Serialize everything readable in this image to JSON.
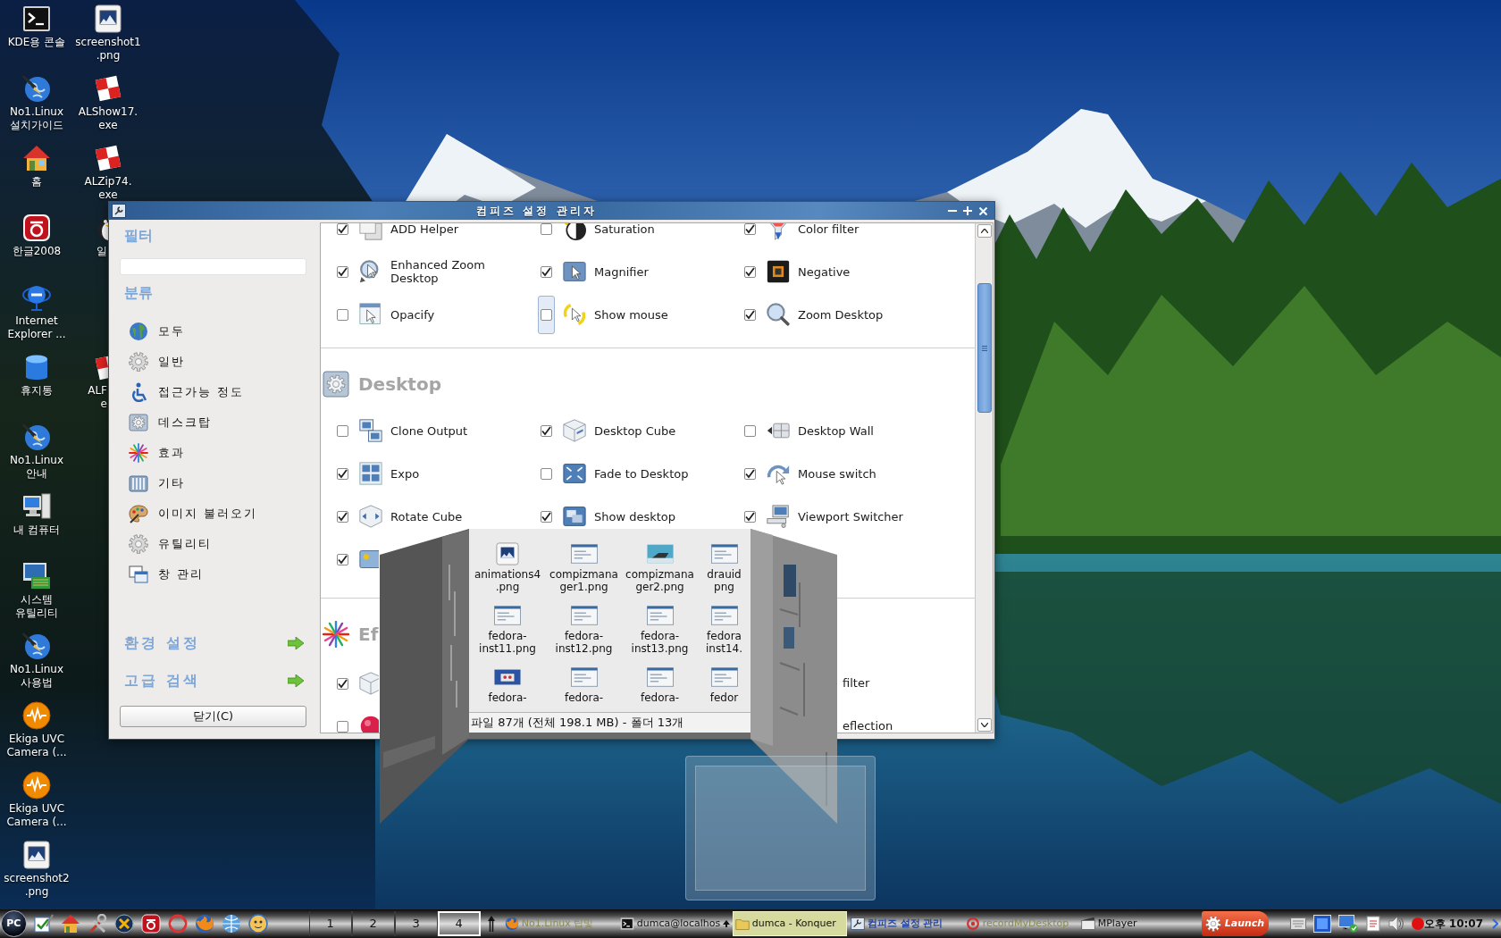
{
  "desktop_icons": {
    "column_1": [
      {
        "lines": [
          "KDE용 콘솔"
        ],
        "kind": "terminal"
      },
      {
        "lines": [
          "No1.Linux",
          "설치가이드"
        ],
        "kind": "globe_pen"
      },
      {
        "lines": [
          "홈"
        ],
        "kind": "house"
      },
      {
        "lines": [
          "한글2008"
        ],
        "kind": "red_badge"
      },
      {
        "lines": [
          "Internet",
          "Explorer ..."
        ],
        "kind": "globe_ring"
      },
      {
        "lines": [
          "휴지통"
        ],
        "kind": "bin"
      },
      {
        "lines": [
          "No1.Linux",
          "안내"
        ],
        "kind": "globe_pen"
      },
      {
        "lines": [
          "내 컴퓨터"
        ],
        "kind": "computer"
      },
      {
        "lines": [
          "시스템",
          "유틸리티"
        ],
        "kind": "monitor_board"
      },
      {
        "lines": [
          "No1.Linux",
          "사용법"
        ],
        "kind": "globe_pen"
      },
      {
        "lines": [
          "Ekiga UVC",
          "Camera (..."
        ],
        "kind": "wave_circle"
      },
      {
        "lines": [
          "Ekiga UVC",
          "Camera (..."
        ],
        "kind": "wave_circle"
      },
      {
        "lines": [
          "screenshot2",
          ".png"
        ],
        "kind": "image_file"
      }
    ],
    "column_2": [
      {
        "lines": [
          "screenshot1",
          ".png"
        ],
        "kind": "image_file"
      },
      {
        "lines": [
          "ALShow17.",
          "exe"
        ],
        "kind": "checker"
      },
      {
        "lines": [
          "ALZip74.",
          "exe"
        ],
        "kind": "checker"
      },
      {
        "lines": [
          "일"
        ],
        "kind": "penguin"
      },
      {
        "lines": [
          "ALF",
          "e"
        ],
        "kind": "checker"
      }
    ]
  },
  "window": {
    "title": "컴피즈 설정 관리자",
    "sidebar": {
      "filter_heading": "필터",
      "category_heading": "분류",
      "categories": [
        {
          "label": "모두",
          "kind": "globe",
          "selected": false
        },
        {
          "label": "일반",
          "kind": "gear",
          "selected": false
        },
        {
          "label": "접근가능 정도",
          "kind": "wheelchair",
          "selected": false
        },
        {
          "label": "데스크탑",
          "kind": "gear_tile",
          "selected": false
        },
        {
          "label": "효과",
          "kind": "starburst",
          "selected": false
        },
        {
          "label": "기타",
          "kind": "pillars",
          "selected": false
        },
        {
          "label": "이미지 불러오기",
          "kind": "palette",
          "selected": false
        },
        {
          "label": "유틸리티",
          "kind": "gear",
          "selected": false
        },
        {
          "label": "창 관리",
          "kind": "windows",
          "selected": false
        }
      ],
      "links": [
        "환경 설정",
        "고급 검색"
      ],
      "close_button": "닫기(C)"
    },
    "plugins": {
      "sections": [
        {
          "rows": [
            [
              {
                "label": "ADD Helper",
                "kind": "add_helper",
                "checked": true,
                "focused": false
              },
              {
                "label": "Saturation",
                "kind": "saturation",
                "checked": false,
                "focused": false
              },
              {
                "label": "Color filter",
                "kind": "color_filter",
                "checked": true,
                "focused": false
              }
            ],
            [
              {
                "label": "Enhanced Zoom Desktop",
                "kind": "enhanced_zoom",
                "checked": true,
                "focused": false
              },
              {
                "label": "Magnifier",
                "kind": "magnifier",
                "checked": true,
                "focused": false
              },
              {
                "label": "Negative",
                "kind": "negative",
                "checked": true,
                "focused": false
              }
            ],
            [
              {
                "label": "Opacify",
                "kind": "opacify",
                "checked": false,
                "focused": false
              },
              {
                "label": "Show mouse",
                "kind": "show_mouse",
                "checked": false,
                "focused": true
              },
              {
                "label": "Zoom Desktop",
                "kind": "zoom_desktop",
                "checked": true,
                "focused": false
              }
            ]
          ]
        },
        {
          "heading": "Desktop",
          "kind": "desktop",
          "rows": [
            [
              {
                "label": "Clone Output",
                "kind": "clone_output",
                "checked": false,
                "focused": false
              },
              {
                "label": "Desktop Cube",
                "kind": "desktop_cube",
                "checked": true,
                "focused": false
              },
              {
                "label": "Desktop Wall",
                "kind": "desktop_wall",
                "checked": false,
                "focused": false
              }
            ],
            [
              {
                "label": "Expo",
                "kind": "expo",
                "checked": true,
                "focused": false
              },
              {
                "label": "Fade to Desktop",
                "kind": "fade_desktop",
                "checked": false,
                "focused": false
              },
              {
                "label": "Mouse switch",
                "kind": "mouse_switch",
                "checked": true,
                "focused": false
              }
            ],
            [
              {
                "label": "Rotate Cube",
                "kind": "rotate_cube",
                "checked": true,
                "focused": false
              },
              {
                "label": "Show desktop",
                "kind": "show_desktop",
                "checked": true,
                "focused": false
              },
              {
                "label": "Viewport Switcher",
                "kind": "viewport_switcher",
                "checked": true,
                "focused": false
              }
            ],
            [
              {
                "kind": "screen_sun",
                "checked": true,
                "focused": false
              }
            ]
          ]
        },
        {
          "heading": "Ef",
          "kind": "effects",
          "rows": [
            [
              {
                "kind": "box",
                "checked": true,
                "focused": false
              },
              {
                "label": "filter"
              }
            ],
            [
              {
                "kind": "red_disc",
                "checked": false,
                "focused": false
              },
              {
                "label": "eflection"
              }
            ]
          ]
        }
      ]
    }
  },
  "cube": {
    "files": [
      {
        "lines": [
          "animations4",
          ".png"
        ],
        "kind": "image"
      },
      {
        "lines": [
          "compizmana",
          "ger1.png"
        ],
        "kind": "screenshot"
      },
      {
        "lines": [
          "compizmana",
          "ger2.png"
        ],
        "kind": "photo"
      },
      {
        "lines": [
          "drauid",
          "png"
        ],
        "kind": "screenshot"
      },
      {
        "lines": [
          "fedora-",
          "inst11.png"
        ],
        "kind": "screenshot"
      },
      {
        "lines": [
          "fedora-",
          "inst12.png"
        ],
        "kind": "screenshot"
      },
      {
        "lines": [
          "fedora-",
          "inst13.png"
        ],
        "kind": "screenshot"
      },
      {
        "lines": [
          "fedora",
          "inst14."
        ],
        "kind": "screenshot"
      },
      {
        "lines": [
          "fedora-"
        ],
        "kind": "dialog"
      },
      {
        "lines": [
          "fedora-"
        ],
        "kind": "screenshot"
      },
      {
        "lines": [
          "fedora-"
        ],
        "kind": "screenshot"
      },
      {
        "lines": [
          "fedor"
        ],
        "kind": "screenshot"
      }
    ],
    "status": "파일 87개 (전체 198.1 MB) - 폴더 13개"
  },
  "taskbar": {
    "start_button": "PC",
    "desktops": [
      {
        "label": "1",
        "selected": false
      },
      {
        "label": "2",
        "selected": false
      },
      {
        "label": "3",
        "selected": false
      },
      {
        "label": "4",
        "selected": true
      }
    ],
    "tasks": [
      {
        "label": "No1.Linux 팁및",
        "kind": "browser",
        "selected": false,
        "minimized": true,
        "focused": false,
        "grouped": false
      },
      {
        "label": "dumca@localhos",
        "kind": "terminal",
        "selected": false,
        "minimized": false,
        "focused": false,
        "grouped": true
      },
      {
        "label": "dumca - Konquer",
        "kind": "folder",
        "selected": true,
        "minimized": false,
        "focused": false,
        "grouped": false
      },
      {
        "label": "컴피즈 설정 관리",
        "kind": "settings",
        "selected": false,
        "minimized": false,
        "focused": true,
        "grouped": false
      },
      {
        "label": "recordMyDesktop",
        "kind": "record",
        "selected": false,
        "minimized": true,
        "focused": false,
        "grouped": false
      },
      {
        "label": "MPlayer",
        "kind": "player",
        "selected": false,
        "minimized": false,
        "focused": false,
        "grouped": false
      }
    ],
    "launch_button": "Launch",
    "clock": "오후 10:07"
  }
}
